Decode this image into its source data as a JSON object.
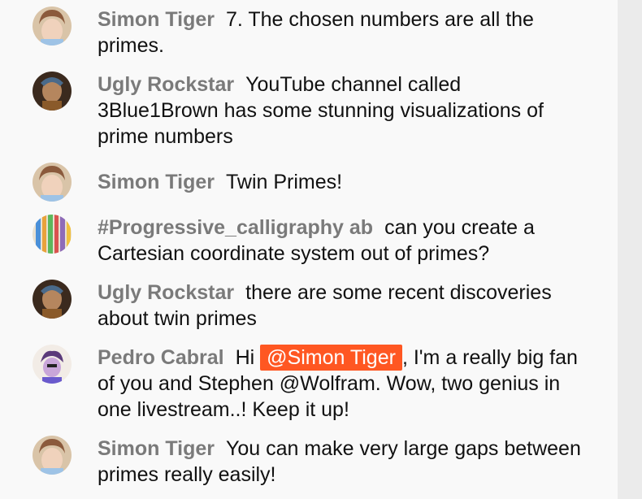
{
  "messages": [
    {
      "author": "Simon Tiger",
      "text": "7. The chosen numbers are all the primes.",
      "avatar_icon": "simon-avatar"
    },
    {
      "author": "Ugly Rockstar",
      "text": "YouTube channel called 3Blue1Brown has some stunning visualizations of prime numbers",
      "avatar_icon": "rockstar-avatar"
    },
    {
      "author": "Simon Tiger",
      "text": "Twin Primes!",
      "avatar_icon": "simon-avatar"
    },
    {
      "author": "#Progressive_calligraphy ab",
      "text": "can you create a Cartesian coordinate system out of primes?",
      "avatar_icon": "calligraphy-avatar"
    },
    {
      "author": "Ugly Rockstar",
      "text": "there are some recent discoveries about twin primes",
      "avatar_icon": "rockstar-avatar"
    },
    {
      "author": "Pedro Cabral",
      "text_before": "Hi",
      "mention": "@Simon Tiger",
      "text_after": ", I'm a really big fan of you and Stephen @Wolfram. Wow, two genius in one livestream..! Keep it up!",
      "avatar_icon": "pedro-avatar"
    },
    {
      "author": "Simon Tiger",
      "text": "You can make very large gaps between primes really easily!",
      "avatar_icon": "simon-avatar"
    }
  ],
  "colors": {
    "mention_bg": "#ff5722",
    "author": "#7a7a7a",
    "background": "#f9f9f9"
  }
}
